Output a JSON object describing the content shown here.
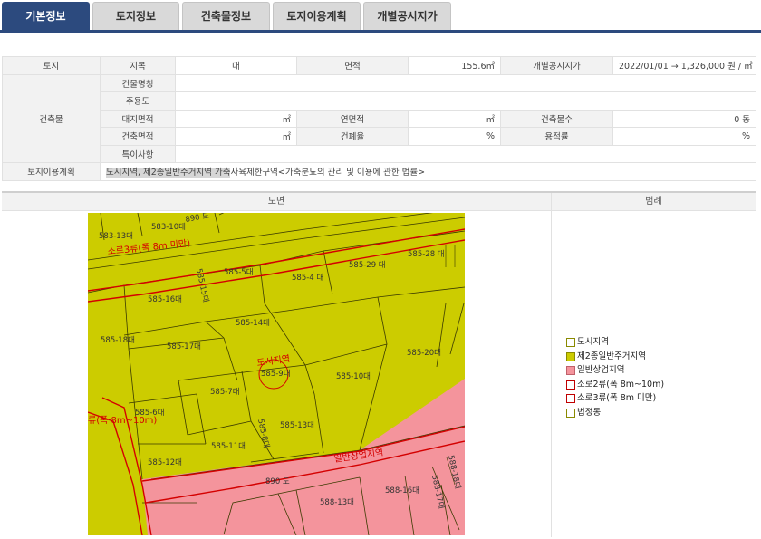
{
  "tabs": [
    {
      "label": "기본정보",
      "active": true
    },
    {
      "label": "토지정보",
      "active": false
    },
    {
      "label": "건축물정보",
      "active": false
    },
    {
      "label": "토지이용계획",
      "active": false
    },
    {
      "label": "개별공시지가",
      "active": false
    }
  ],
  "info": {
    "land_h": "토지",
    "jimok_h": "지목",
    "jimok_v": "대",
    "area_h": "면적",
    "area_v": "155.6㎡",
    "price_h": "개별공시지가",
    "price_v": "2022/01/01 → 1,326,000 원 / ㎡",
    "bldg_h": "건축물",
    "bname_h": "건물명칭",
    "use_h": "주용도",
    "site_area_h": "대지면적",
    "site_area_v": "㎡",
    "floor_area_h": "연면적",
    "floor_area_v": "㎡",
    "floors_h": "건축물수",
    "floors_v": "0 동",
    "build_area_h": "건축면적",
    "build_area_v": "㎡",
    "bcr_h": "건폐율",
    "bcr_v": "%",
    "far_h": "용적률",
    "far_v": "%",
    "note_h": "특이사항",
    "plan_h": "토지이용계획",
    "plan_hl": "도시지역, 제2종일반주거지역 가축",
    "plan_rest": "사육제한구역<가축분뇨의 관리 및 이용에 관한 법률>"
  },
  "map": {
    "header_map": "도면",
    "header_legend": "범례",
    "labels": {
      "l583_13": "583-13대",
      "l583_10": "583-10대",
      "l585_5": "585-5대",
      "l585_4": "585-4 대",
      "l585_29": "585-29 대",
      "l585_28": "585-28 대",
      "l585_16": "585-16대",
      "l585_15": "585-15대",
      "l585_14": "585-14대",
      "l585_18": "585-18대",
      "l585_17": "585-17대",
      "l585_9": "585-9대",
      "l585_10": "585-10대",
      "l585_20": "585-20대",
      "l585_7": "585-7대",
      "l585_6": "585-6대",
      "l585_13": "585-13대",
      "l585_8": "585-8대",
      "l585_11": "585-11대",
      "l585_12": "585-12대",
      "l890a": "890 도",
      "l890b": "890 도",
      "l588_13": "588-13대",
      "l588_16": "588-16대",
      "l588_17": "588-17대",
      "l588_18": "588-18대",
      "road3": "소로3류(폭 8m 미만)",
      "road2": "류(폭 8m~10m)",
      "urban": "도시지역",
      "commercial": "일반상업지역"
    }
  },
  "legend": [
    {
      "label": "도시지역",
      "color": "#ffffff",
      "border": "#8a8a00"
    },
    {
      "label": "제2종일반주거지역",
      "color": "#cccc00",
      "border": "#8a8a00"
    },
    {
      "label": "일반상업지역",
      "color": "#f4949c",
      "border": "#c0606a"
    },
    {
      "label": "소로2류(폭 8m~10m)",
      "color": "#ffffff",
      "border": "#c00000"
    },
    {
      "label": "소로3류(폭 8m 미만)",
      "color": "#ffffff",
      "border": "#c00000"
    },
    {
      "label": "법정동",
      "color": "#ffffff",
      "border": "#8a8a00"
    }
  ],
  "colors": {
    "tab_active": "#2c4a7e",
    "residential": "#cccc00",
    "commercial": "#f4949c",
    "road": "#d40000"
  }
}
